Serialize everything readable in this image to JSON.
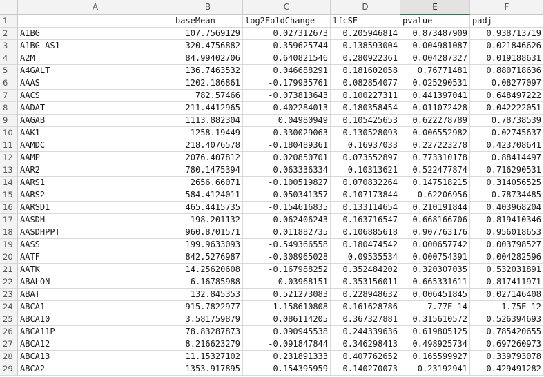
{
  "columns": [
    "A",
    "B",
    "C",
    "D",
    "E",
    "F"
  ],
  "selected_column": "E",
  "row_numbers": [
    "1",
    "2",
    "3",
    "4",
    "5",
    "6",
    "7",
    "8",
    "9",
    "10",
    "11",
    "12",
    "13",
    "14",
    "15",
    "16",
    "17",
    "18",
    "19",
    "20",
    "21",
    "22",
    "23",
    "24",
    "25",
    "26",
    "27",
    "28",
    "29"
  ],
  "header_row": [
    "",
    "baseMean",
    "log2FoldChange",
    "lfcSE",
    "pvalue",
    "padj"
  ],
  "rows": [
    [
      "A1BG",
      "107.7569129",
      "0.027312673",
      "0.205946814",
      "0.873487909",
      "0.938713719"
    ],
    [
      "A1BG-AS1",
      "320.4756882",
      "0.359625744",
      "0.138593004",
      "0.004981087",
      "0.021846626"
    ],
    [
      "A2M",
      "84.99402706",
      "0.640821546",
      "0.280922361",
      "0.004287327",
      "0.019188631"
    ],
    [
      "A4GALT",
      "136.7463532",
      "0.046688291",
      "0.181602058",
      "0.76771481",
      "0.880718636"
    ],
    [
      "AAAS",
      "1202.186861",
      "-0.179935761",
      "0.082854077",
      "0.025290531",
      "0.08277097"
    ],
    [
      "AACS",
      "782.57466",
      "-0.073813643",
      "0.100227311",
      "0.441397041",
      "0.648497222"
    ],
    [
      "AADAT",
      "211.4412965",
      "-0.402284013",
      "0.180358454",
      "0.011072428",
      "0.042222051"
    ],
    [
      "AAGAB",
      "1113.882304",
      "0.04980949",
      "0.105425653",
      "0.622278789",
      "0.78738539"
    ],
    [
      "AAK1",
      "1258.19449",
      "-0.330029063",
      "0.130528093",
      "0.006552982",
      "0.02745637"
    ],
    [
      "AAMDC",
      "218.4076578",
      "-0.180489361",
      "0.16937033",
      "0.227223278",
      "0.423708641"
    ],
    [
      "AAMP",
      "2076.407812",
      "0.020850701",
      "0.073552897",
      "0.773310178",
      "0.88414497"
    ],
    [
      "AAR2",
      "780.1475394",
      "0.063336334",
      "0.10313621",
      "0.522477874",
      "0.716290531"
    ],
    [
      "AARS1",
      "2656.66071",
      "-0.100519827",
      "0.070832264",
      "0.147518215",
      "0.314056525"
    ],
    [
      "AARS2",
      "584.4124011",
      "-0.050341357",
      "0.107173844",
      "0.62206956",
      "0.78734485"
    ],
    [
      "AARSD1",
      "465.4415735",
      "-0.154616835",
      "0.133114654",
      "0.210191844",
      "0.403968204"
    ],
    [
      "AASDH",
      "198.201132",
      "-0.062406243",
      "0.163716547",
      "0.668166706",
      "0.819410346"
    ],
    [
      "AASDHPPT",
      "960.8701571",
      "0.011882735",
      "0.106885618",
      "0.907763176",
      "0.956018653"
    ],
    [
      "AASS",
      "199.9633093",
      "-0.549366558",
      "0.180474542",
      "0.000657742",
      "0.003798527"
    ],
    [
      "AATF",
      "842.5276987",
      "-0.308965028",
      "0.09535534",
      "0.000754391",
      "0.004282596"
    ],
    [
      "AATK",
      "14.25620608",
      "-0.167988252",
      "0.352484202",
      "0.320307035",
      "0.532031891"
    ],
    [
      "ABALON",
      "6.16785988",
      "-0.03968151",
      "0.353156011",
      "0.665331611",
      "0.817411971"
    ],
    [
      "ABAT",
      "132.845353",
      "0.521273083",
      "0.228948632",
      "0.006451845",
      "0.027146408"
    ],
    [
      "ABCA1",
      "915.7822977",
      "1.158610808",
      "0.161628786",
      "7.77E-14",
      "1.75E-12"
    ],
    [
      "ABCA10",
      "3.581759879",
      "0.086114205",
      "0.367327881",
      "0.315610572",
      "0.526394693"
    ],
    [
      "ABCA11P",
      "78.83287873",
      "0.090945538",
      "0.244339636",
      "0.619805125",
      "0.785420655"
    ],
    [
      "ABCA12",
      "8.216623279",
      "-0.091847844",
      "0.346298413",
      "0.498925734",
      "0.697260973"
    ],
    [
      "ABCA13",
      "11.15327102",
      "0.231891333",
      "0.407762652",
      "0.165599927",
      "0.339793078"
    ],
    [
      "ABCA2",
      "1353.917895",
      "0.154395959",
      "0.140270073",
      "0.23192941",
      "0.429491282"
    ]
  ]
}
